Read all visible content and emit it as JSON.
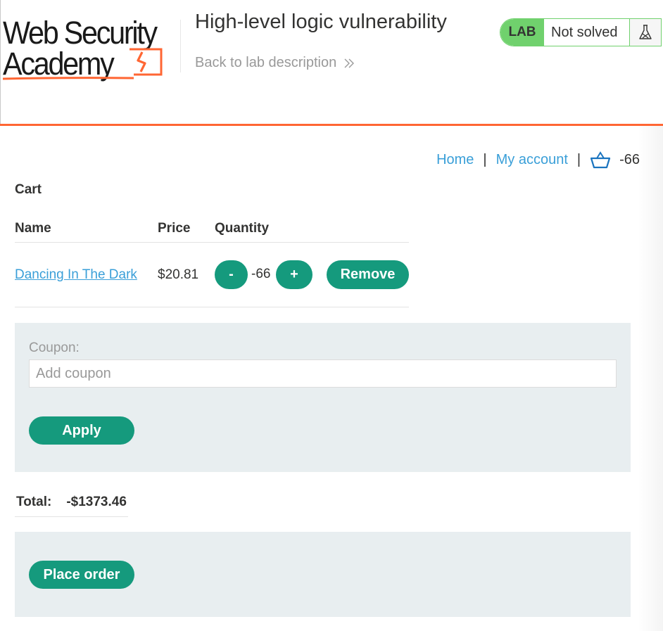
{
  "header": {
    "logo": {
      "line1": "Web Security",
      "line2": "Academy"
    },
    "lab_title": "High-level logic vulnerability",
    "back_link": "Back to lab description",
    "lab_badge": "LAB",
    "lab_status": "Not solved",
    "icons": {
      "back": "double-chevron-right-icon",
      "flask": "flask-icon"
    },
    "accent_color": "#ff6633",
    "status_color": "#70d16d"
  },
  "nav": {
    "home": "Home",
    "separator": "|",
    "my_account": "My account",
    "cart_icon": "basket-icon",
    "cart_count": "-66"
  },
  "page_heading": "Cart",
  "cart": {
    "columns": [
      "Name",
      "Price",
      "Quantity"
    ],
    "items": [
      {
        "name": "Dancing In The Dark",
        "price": "$20.81",
        "decrement_label": "-",
        "quantity": "-66",
        "increment_label": "+",
        "remove_label": "Remove"
      }
    ]
  },
  "coupon": {
    "label": "Coupon:",
    "placeholder": "Add coupon",
    "apply_label": "Apply"
  },
  "total": {
    "label": "Total:",
    "value": "-$1373.46"
  },
  "place_order_label": "Place order",
  "colors": {
    "button": "#159a7d",
    "link": "#3a9fd8",
    "panel": "#e8eef0"
  }
}
